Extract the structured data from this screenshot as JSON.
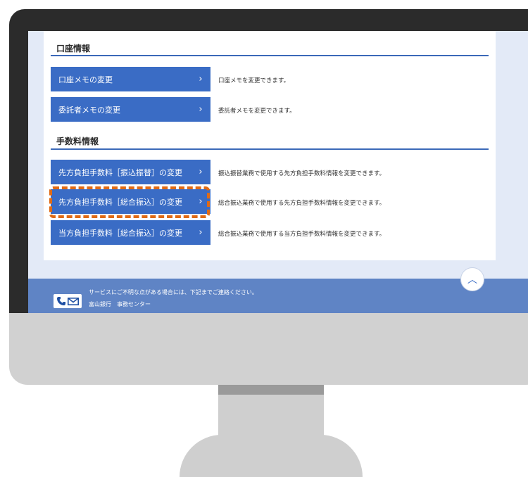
{
  "sections": [
    {
      "title": "口座情報",
      "items": [
        {
          "label": "口座メモの変更",
          "description": "口座メモを変更できます。"
        },
        {
          "label": "委託者メモの変更",
          "description": "委託者メモを変更できます。"
        }
      ]
    },
    {
      "title": "手数料情報",
      "items": [
        {
          "label": "先方負担手数料［振込振替］の変更",
          "description": "振込振替業務で使用する先方負担手数料情報を変更できます。"
        },
        {
          "label": "先方負担手数料［総合振込］の変更",
          "description": "総合振込業務で使用する先方負担手数料情報を変更できます。"
        },
        {
          "label": "当方負担手数料［総合振込］の変更",
          "description": "総合振込業務で使用する当方負担手数料情報を変更できます。"
        }
      ]
    }
  ],
  "chevron": "›",
  "scroll_top_icon": "chevron-up-icon",
  "scroll_top_glyph": "︿",
  "footer": {
    "line1": "サービスにご不明な点がある場合には、下記までご連絡ください。",
    "line2": "富山銀行　事務センター",
    "icon": "phone-mail-icon"
  },
  "colors": {
    "button": "#3a6cc5",
    "highlight": "#e06a14",
    "footer": "#5f84c5"
  }
}
